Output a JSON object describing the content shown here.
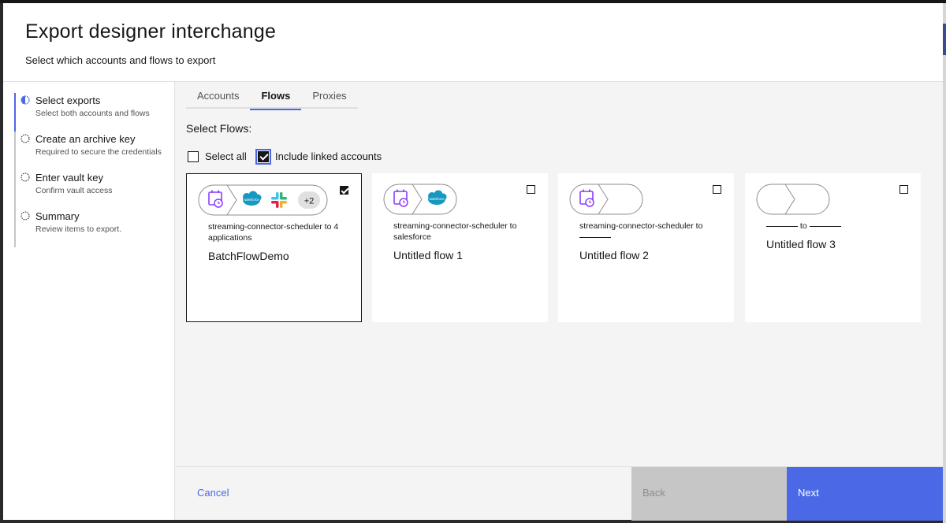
{
  "modal": {
    "title": "Export designer interchange",
    "subtitle": "Select which accounts and flows to export"
  },
  "steps": [
    {
      "label": "Select exports",
      "desc": "Select both accounts and flows",
      "state": "current"
    },
    {
      "label": "Create an archive key",
      "desc": "Required to secure the credentials",
      "state": "incomplete"
    },
    {
      "label": "Enter vault key",
      "desc": "Confirm vault access",
      "state": "incomplete"
    },
    {
      "label": "Summary",
      "desc": "Review items to export.",
      "state": "incomplete"
    }
  ],
  "tabs": [
    {
      "label": "Accounts",
      "selected": false
    },
    {
      "label": "Flows",
      "selected": true
    },
    {
      "label": "Proxies",
      "selected": false
    }
  ],
  "section_label": "Select Flows:",
  "select_all": {
    "label": "Select all",
    "checked": false
  },
  "include_linked": {
    "label": "Include linked accounts",
    "checked": true
  },
  "flows": [
    {
      "desc": "streaming-connector-scheduler to 4 applications",
      "name": "BatchFlowDemo",
      "checked": true,
      "apps": [
        "scheduler",
        "salesforce",
        "slack"
      ],
      "more": "+2"
    },
    {
      "desc": "streaming-connector-scheduler to salesforce",
      "name": "Untitled flow 1",
      "checked": false,
      "apps": [
        "scheduler",
        "salesforce"
      ]
    },
    {
      "desc_prefix": "streaming-connector-scheduler to",
      "name": "Untitled flow 2",
      "checked": false,
      "apps": [
        "scheduler"
      ]
    },
    {
      "to_label": "to",
      "name": "Untitled flow 3",
      "checked": false,
      "apps": []
    }
  ],
  "salesforce_logo_text": "salesforce",
  "footer": {
    "cancel": "Cancel",
    "back": "Back",
    "next": "Next"
  },
  "colors": {
    "accent": "#4b68e6",
    "scheduler_icon": "#8a3ffc",
    "salesforce": "#1798c1"
  }
}
